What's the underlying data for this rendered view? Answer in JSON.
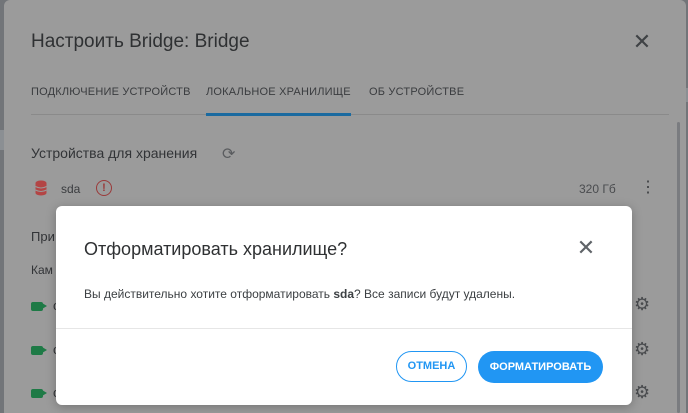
{
  "dialog": {
    "title": "Настроить Bridge: Bridge",
    "tabs": [
      {
        "label": "ПОДКЛЮЧЕНИЕ УСТРОЙСТВ",
        "active": false
      },
      {
        "label": "ЛОКАЛЬНОЕ ХРАНИЛИЩЕ",
        "active": true
      },
      {
        "label": "ОБ УСТРОЙСТВЕ",
        "active": false
      }
    ],
    "storage_section_title": "Устройства для хранения",
    "drive": {
      "name": "sda",
      "size": "320 Гб",
      "warning_glyph": "!"
    },
    "partial_labels": [
      "При",
      "Кам"
    ],
    "camera_row_glyphs": [
      "с",
      "с",
      "с"
    ]
  },
  "modal": {
    "title": "Отформатировать хранилище?",
    "body_prefix": "Вы действительно хотите отформатировать ",
    "body_bold": "sda",
    "body_suffix": "? Все записи будут удалены.",
    "cancel_label": "ОТМЕНА",
    "format_label": "ФОРМАТИРОВАТЬ"
  },
  "colors": {
    "accent": "#2196f3",
    "tab_underline": "#1a6aa0",
    "overlay_dialog": "#9b9b9b",
    "drive_icon": "#c62828",
    "camera_icon": "#1e7a46"
  },
  "icons": {
    "close": "close-icon",
    "refresh": "refresh-icon",
    "database": "database-icon",
    "warning": "warning-icon",
    "kebab": "kebab-menu-icon",
    "camera": "camera-icon",
    "gear": "gear-icon"
  }
}
